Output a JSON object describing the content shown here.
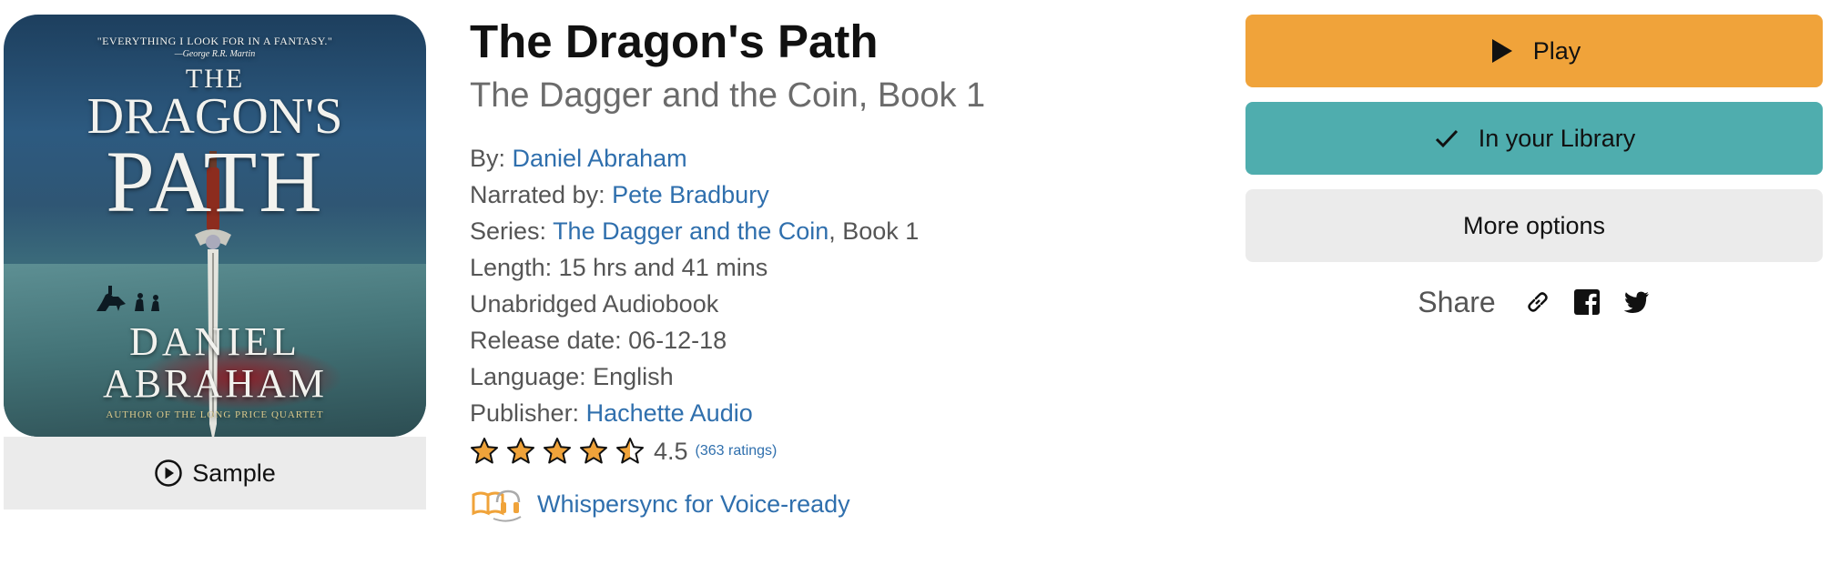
{
  "cover": {
    "quote": "\"EVERYTHING I LOOK FOR IN A FANTASY.\"",
    "quote_attribution": "—George R.R. Martin",
    "title_line1": "THE",
    "title_line2": "DRAGON'S",
    "title_line3": "PATH",
    "author_line1": "DANIEL",
    "author_line2": "ABRAHAM",
    "tagline": "AUTHOR OF THE LONG PRICE QUARTET"
  },
  "sample": {
    "label": "Sample",
    "icon": "play-circle-icon"
  },
  "book": {
    "title": "The Dragon's Path",
    "subtitle": "The Dagger and the Coin, Book 1"
  },
  "meta": {
    "by_label": "By:",
    "author": "Daniel Abraham",
    "narrated_label": "Narrated by:",
    "narrator": "Pete Bradbury",
    "series_label": "Series:",
    "series_name": "The Dagger and the Coin",
    "series_suffix": ", Book 1",
    "length": "Length: 15 hrs and 41 mins",
    "format": "Unabridged Audiobook",
    "release": "Release date: 06-12-18",
    "language": "Language: English",
    "publisher_label": "Publisher:",
    "publisher": "Hachette Audio"
  },
  "rating": {
    "value": "4.5",
    "stars": 4.5,
    "count": "(363 ratings)"
  },
  "whispersync": {
    "label": "Whispersync for Voice-ready",
    "icon": "book-headphones-icon"
  },
  "actions": {
    "play": "Play",
    "library": "In your Library",
    "more": "More options",
    "share": "Share"
  },
  "colors": {
    "play": "#f0a33a",
    "library": "#4fadae",
    "more": "#ebebeb",
    "link": "#2f6fad",
    "star": "#f0a33a"
  }
}
